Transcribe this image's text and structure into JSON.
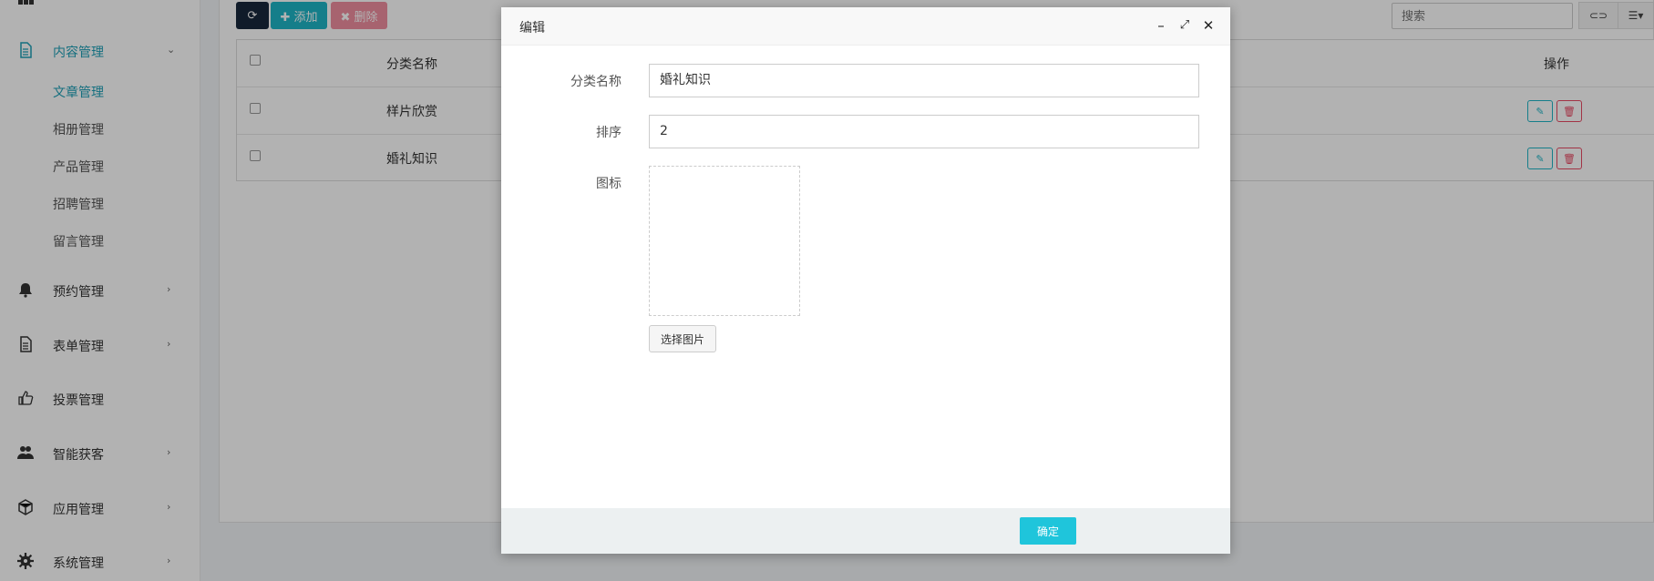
{
  "sidebar": {
    "groups": [
      {
        "label": "内容管理",
        "icon": "document-icon",
        "expanded": true
      },
      {
        "label": "预约管理",
        "icon": "bell-icon"
      },
      {
        "label": "表单管理",
        "icon": "file-text-icon"
      },
      {
        "label": "投票管理",
        "icon": "thumbs-up-icon"
      },
      {
        "label": "智能获客",
        "icon": "users-icon"
      },
      {
        "label": "应用管理",
        "icon": "cube-icon"
      },
      {
        "label": "系统管理",
        "icon": "gear-icon"
      }
    ],
    "content_items": [
      "文章管理",
      "相册管理",
      "产品管理",
      "招聘管理",
      "留言管理"
    ],
    "active_item": "文章管理"
  },
  "toolbar": {
    "refresh_icon": "refresh-icon",
    "add_label": "✚ 添加",
    "delete_label": "✖ 删除",
    "search_placeholder": "搜索"
  },
  "table": {
    "headers": {
      "name": "分类名称",
      "actions": "操作"
    },
    "rows": [
      {
        "name": "样片欣赏"
      },
      {
        "name": "婚礼知识"
      }
    ]
  },
  "modal": {
    "title": "编辑",
    "fields": {
      "name_label": "分类名称",
      "name_value": "婚礼知识",
      "sort_label": "排序",
      "sort_value": "2",
      "icon_label": "图标"
    },
    "pick_image_label": "选择图片",
    "confirm_label": "确定"
  },
  "colors": {
    "accent": "#1fb5c6",
    "danger": "#e94a64",
    "active_text": "#1e9fb6",
    "dark_button": "#18273b"
  }
}
